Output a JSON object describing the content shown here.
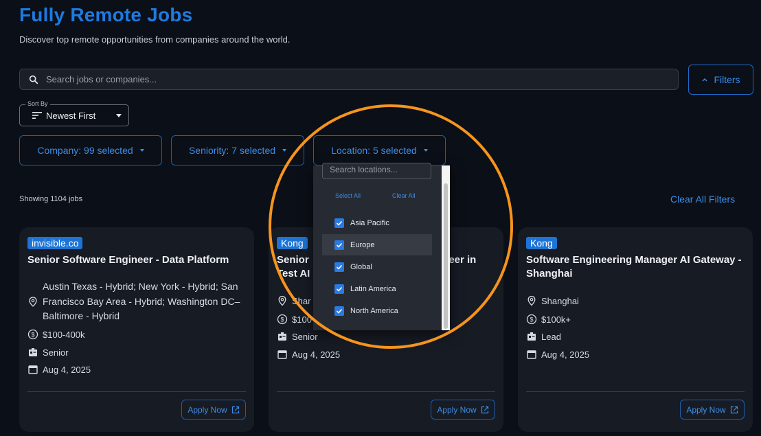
{
  "header": {
    "title": "Fully Remote Jobs",
    "subtitle": "Discover top remote opportunities from companies around the world."
  },
  "search": {
    "placeholder": "Search jobs or companies..."
  },
  "filters_button": {
    "label": "Filters"
  },
  "sort": {
    "label": "Sort By",
    "value": "Newest First"
  },
  "filter_chips": {
    "company": "Company: 99 selected",
    "seniority": "Seniority: 7 selected",
    "location": "Location: 5 selected"
  },
  "results": {
    "showing": "Showing 1104 jobs",
    "clear_all": "Clear All Filters"
  },
  "location_dropdown": {
    "search_placeholder": "Search locations...",
    "select_all": "Select All",
    "clear_all": "Clear All",
    "options": [
      {
        "label": "Asia Pacific",
        "checked": true
      },
      {
        "label": "Europe",
        "checked": true
      },
      {
        "label": "Global",
        "checked": true
      },
      {
        "label": "Latin America",
        "checked": true
      },
      {
        "label": "North America",
        "checked": true
      }
    ]
  },
  "jobs": [
    {
      "company": "invisible.co",
      "title": "Senior Software Engineer - Data Platform",
      "location": "Austin Texas - Hybrid; New York - Hybrid; San Francisco Bay Area - Hybrid; Washington DC–Baltimore - Hybrid",
      "salary": "$100-400k",
      "seniority": "Senior",
      "date": "Aug 4, 2025",
      "apply": "Apply Now"
    },
    {
      "company": "Kong",
      "title_part1": "Senior",
      "title_part2": "ineer in",
      "title_part3": "Test AI",
      "location": "Shar",
      "salary": "$100",
      "seniority": "Senior",
      "date": "Aug 4, 2025",
      "apply": "Apply Now"
    },
    {
      "company": "Kong",
      "title": "Software Engineering Manager AI Gateway - Shanghai",
      "location": "Shanghai",
      "salary": "$100k+",
      "seniority": "Lead",
      "date": "Aug 4, 2025",
      "apply": "Apply Now"
    }
  ],
  "colors": {
    "accent": "#1e7ae0",
    "highlight_ring": "#f7941d",
    "background": "#0b0f17",
    "card": "#171b24"
  }
}
